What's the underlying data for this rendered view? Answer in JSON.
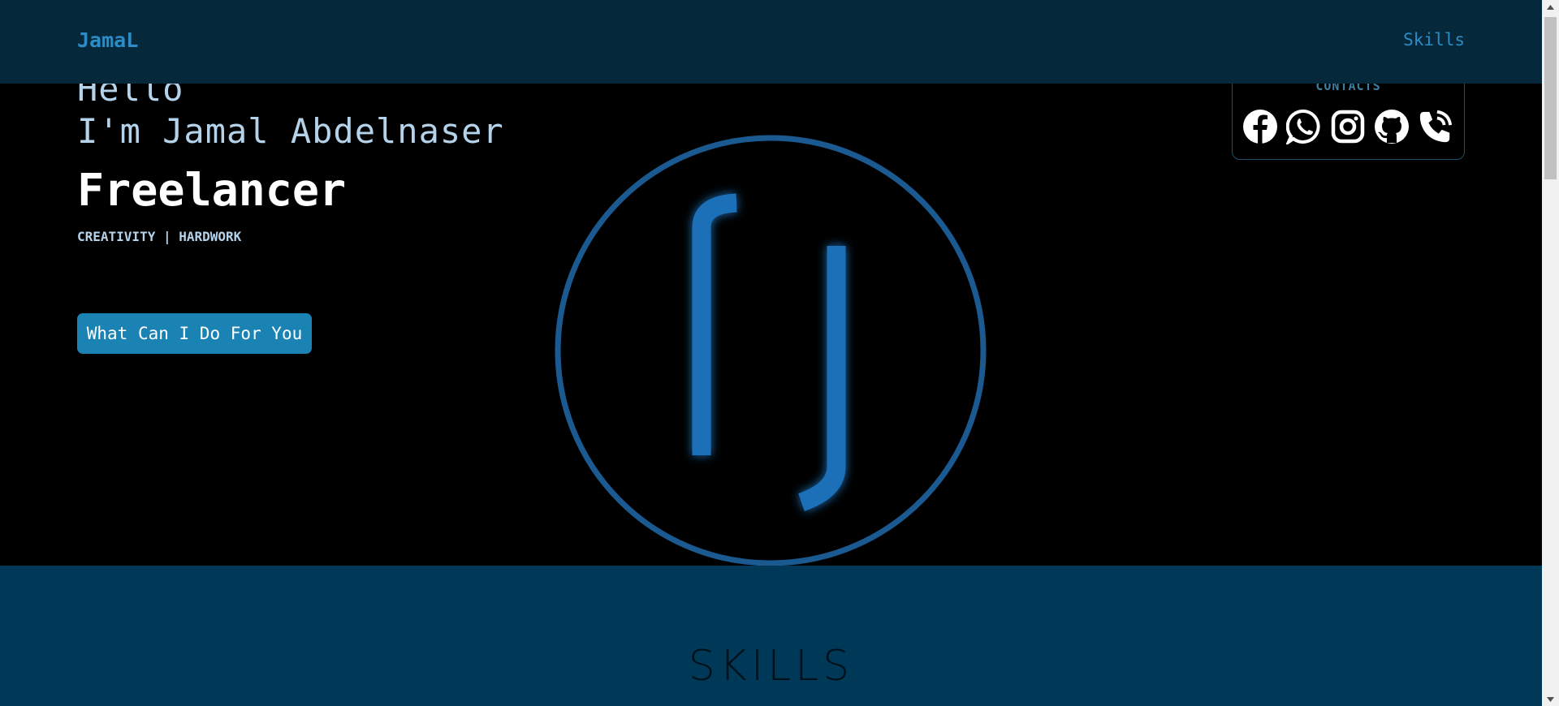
{
  "nav": {
    "brand": "JamaL",
    "links": [
      "Skills"
    ]
  },
  "hero": {
    "greeting_line1": "Hello",
    "greeting_line2": "I'm Jamal Abdelnaser",
    "role": "Freelancer",
    "tagline": "CREATIVITY | HARDWORK",
    "cta_label": "What Can I Do For You"
  },
  "contacts": {
    "title": "CONTACTS",
    "icons": [
      "facebook-icon",
      "whatsapp-icon",
      "instagram-icon",
      "github-icon",
      "phone-icon"
    ]
  },
  "skills": {
    "title": "SKILLS"
  },
  "colors": {
    "navbar_bg": "#05283b",
    "accent": "#1b83b4",
    "logo_blue": "#1f6fb8",
    "skills_bg": "#003957"
  }
}
